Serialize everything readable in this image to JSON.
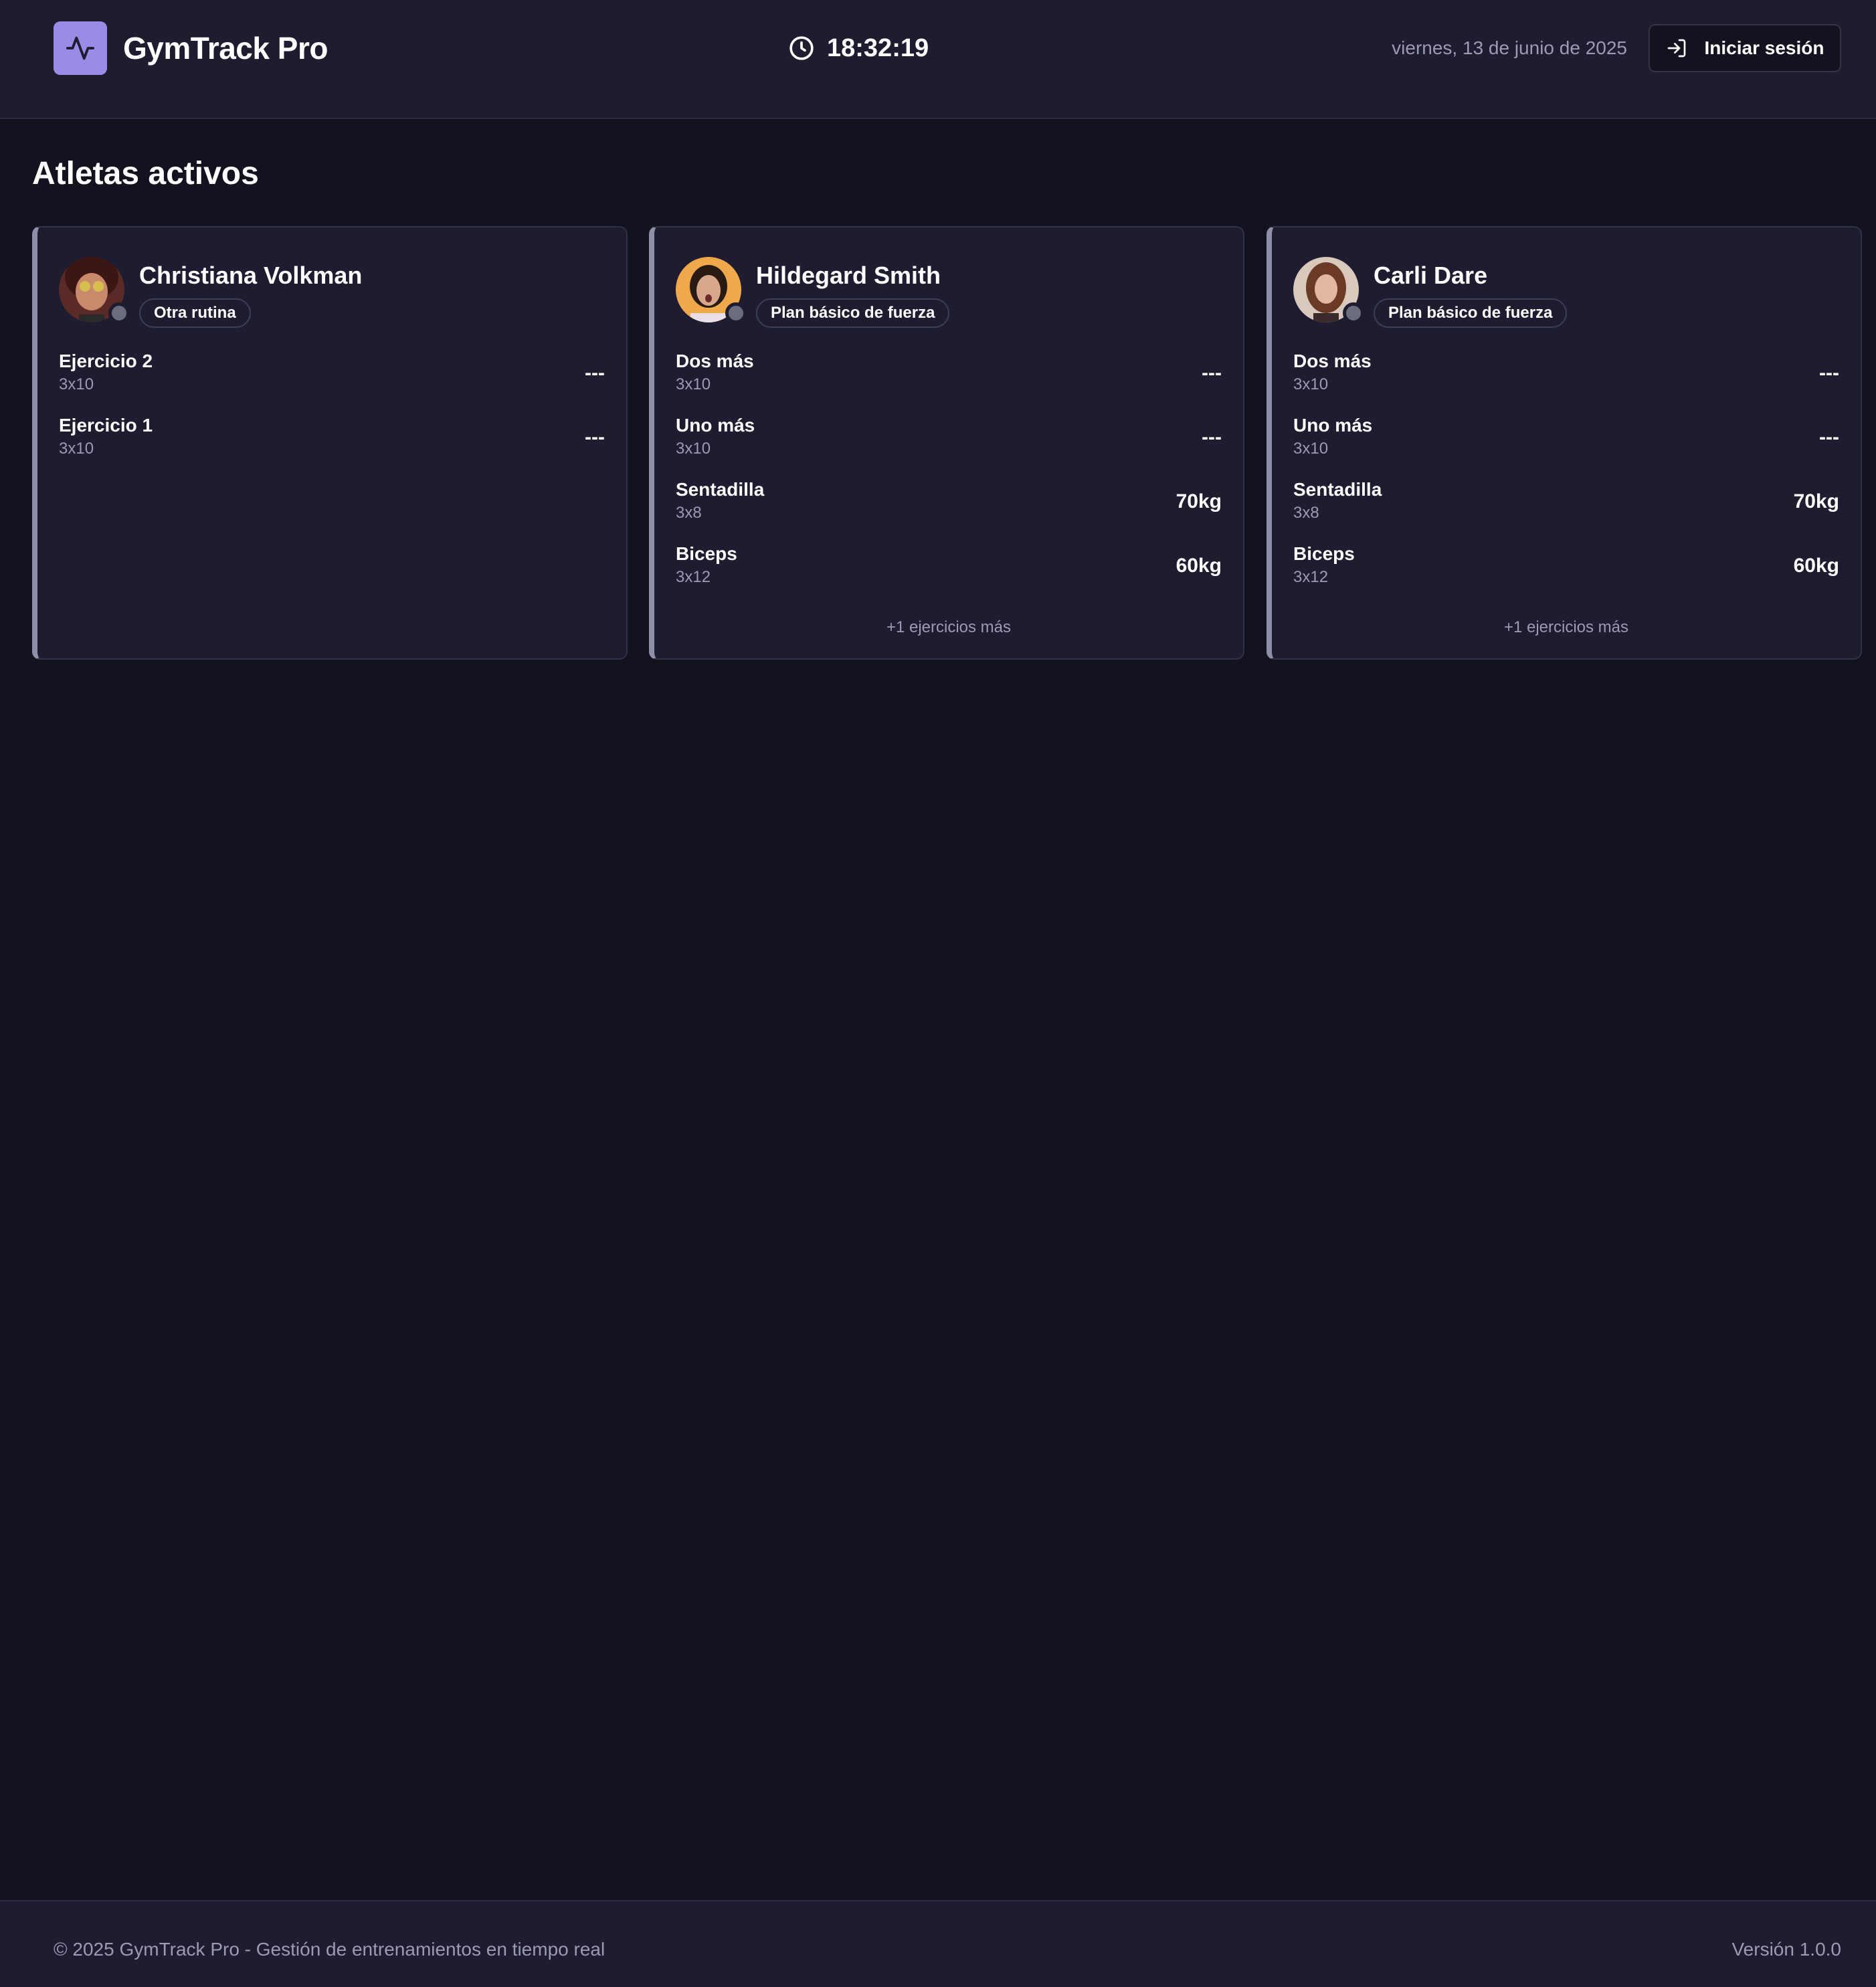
{
  "header": {
    "app_title": "GymTrack Pro",
    "clock": "18:32:19",
    "date": "viernes, 13 de junio de 2025",
    "login_label": "Iniciar sesión",
    "logo_icon": "activity-pulse-icon",
    "clock_icon": "clock-icon",
    "login_icon": "log-in-icon"
  },
  "main": {
    "section_title": "Atletas activos",
    "athletes": [
      {
        "name": "Christiana Volkman",
        "routine": "Otra rutina",
        "exercises": [
          {
            "name": "Ejercicio 2",
            "sets": "3x10",
            "weight": "---"
          },
          {
            "name": "Ejercicio 1",
            "sets": "3x10",
            "weight": "---"
          }
        ],
        "more": ""
      },
      {
        "name": "Hildegard Smith",
        "routine": "Plan básico de fuerza",
        "exercises": [
          {
            "name": "Dos más",
            "sets": "3x10",
            "weight": "---"
          },
          {
            "name": "Uno más",
            "sets": "3x10",
            "weight": "---"
          },
          {
            "name": "Sentadilla",
            "sets": "3x8",
            "weight": "70kg"
          },
          {
            "name": "Biceps",
            "sets": "3x12",
            "weight": "60kg"
          }
        ],
        "more": "+1 ejercicios más"
      },
      {
        "name": "Carli Dare",
        "routine": "Plan básico de fuerza",
        "exercises": [
          {
            "name": "Dos más",
            "sets": "3x10",
            "weight": "---"
          },
          {
            "name": "Uno más",
            "sets": "3x10",
            "weight": "---"
          },
          {
            "name": "Sentadilla",
            "sets": "3x8",
            "weight": "70kg"
          },
          {
            "name": "Biceps",
            "sets": "3x12",
            "weight": "60kg"
          }
        ],
        "more": "+1 ejercicios más"
      }
    ]
  },
  "footer": {
    "copyright": "© 2025 GymTrack Pro - Gestión de entrenamientos en tiempo real",
    "version": "Versión 1.0.0"
  },
  "colors": {
    "background": "#13131f",
    "surface": "#1d1c30",
    "accent": "#9b8ae6",
    "muted_text": "#9c9bb3",
    "status_offline": "#6b6c7c"
  }
}
